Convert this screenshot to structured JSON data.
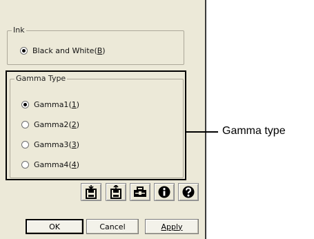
{
  "ink": {
    "group_label": "Ink",
    "option_label": "Black and White",
    "option_hotkey": "B",
    "selected": true
  },
  "gamma": {
    "group_label": "Gamma Type",
    "options": [
      {
        "label": "Gamma1",
        "hotkey": "1",
        "selected": true
      },
      {
        "label": "Gamma2",
        "hotkey": "2",
        "selected": false
      },
      {
        "label": "Gamma3",
        "hotkey": "3",
        "selected": false
      },
      {
        "label": "Gamma4",
        "hotkey": "4",
        "selected": false
      }
    ]
  },
  "toolbar": {
    "icons": [
      "save-icon",
      "load-icon",
      "toolbox-icon",
      "info-icon",
      "help-icon"
    ]
  },
  "footer": {
    "ok_label": "OK",
    "cancel_label": "Cancel",
    "apply_label": "Apply"
  },
  "callout": {
    "text": "Gamma type"
  },
  "colors": {
    "dialog_bg": "#ece9d8",
    "group_border": "#aca899",
    "highlight": "#000000"
  }
}
